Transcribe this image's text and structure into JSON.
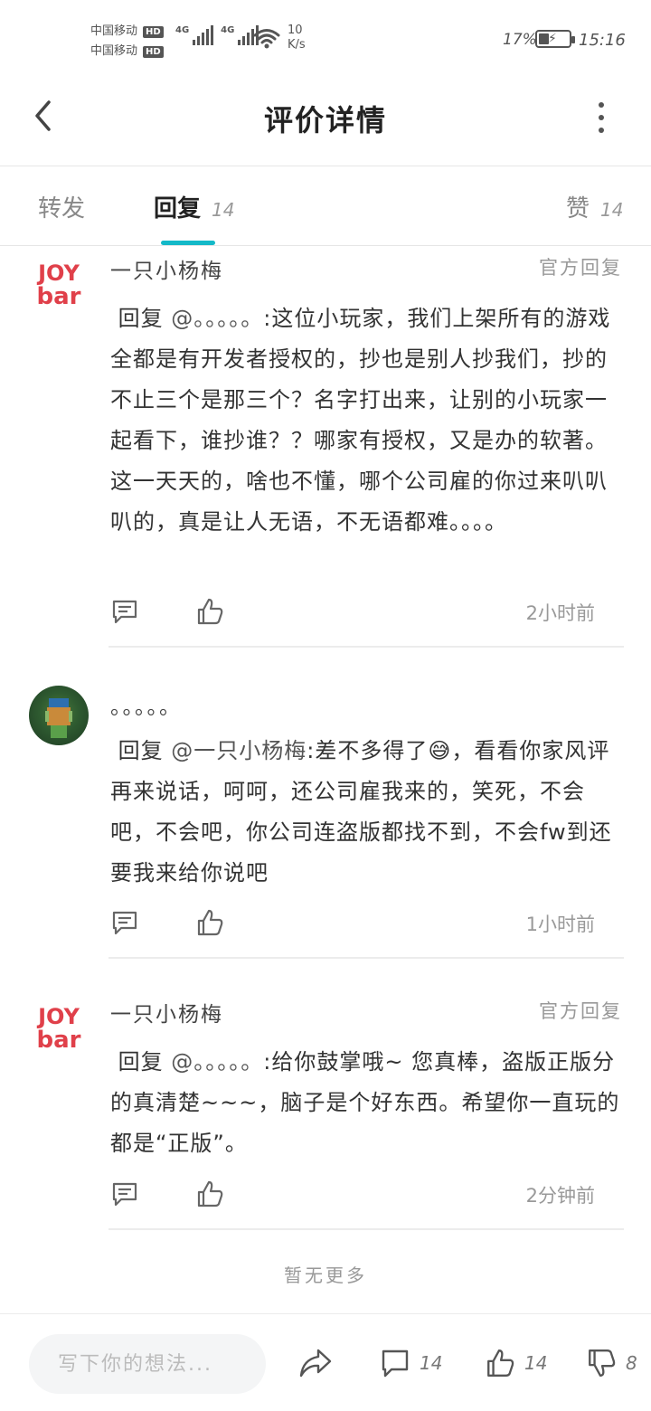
{
  "status_bar": {
    "carrier_1": "中国移动",
    "carrier_2": "中国移动",
    "hd_label": "HD",
    "net_type": "4G",
    "speed_value": "10",
    "speed_unit": "K/s",
    "battery_pct": "17%",
    "battery_level": 0.17,
    "time": "15:16"
  },
  "header": {
    "title": "评价详情",
    "back_icon": "chevron-left-icon",
    "more_icon": "more-vertical-icon"
  },
  "tabs": [
    {
      "label": "转发",
      "count": ""
    },
    {
      "label": "回复",
      "count": "14",
      "active": true
    },
    {
      "label": "赞",
      "count": "14"
    }
  ],
  "comments": [
    {
      "author": "一只小杨梅",
      "badge": "官方回复",
      "avatar": "joybar-logo",
      "reply_prefix": "回复",
      "mention": "@。。。。。",
      "text": ":这位小玩家，我们上架所有的游戏全都是有开发者授权的，抄也是别人抄我们，抄的不止三个是那三个？名字打出来，让别的小玩家一起看下，谁抄谁？？哪家有授权，又是办的软著。这一天天的，啥也不懂，哪个公司雇的你过来叭叭叭的，真是让人无语，不无语都难。。。。",
      "time": "2小时前"
    },
    {
      "author": "。。。。。",
      "badge": "",
      "avatar": "user-avatar",
      "reply_prefix": "回复",
      "mention": "@一只小杨梅",
      "text": ":差不多得了😅，看看你家风评再来说话，呵呵，还公司雇我来的，笑死，不会吧，不会吧，你公司连盗版都找不到，不会fw到还要我来给你说吧",
      "time": "1小时前"
    },
    {
      "author": "一只小杨梅",
      "badge": "官方回复",
      "avatar": "joybar-logo",
      "reply_prefix": "回复",
      "mention": "@。。。。。",
      "text": ":给你鼓掌哦~ 您真棒，盗版正版分的真清楚~~~，脑子是个好东西。希望你一直玩的都是“正版”。",
      "time": "2分钟前"
    }
  ],
  "no_more_text": "暂无更多",
  "bottom_bar": {
    "input_placeholder": "写下你的想法...",
    "comment_count": "14",
    "like_count": "14",
    "dislike_count": "8"
  },
  "colors": {
    "accent": "#14b9c8",
    "brand_red": "#e0404a",
    "text_primary": "#333333",
    "text_secondary": "#999999"
  }
}
